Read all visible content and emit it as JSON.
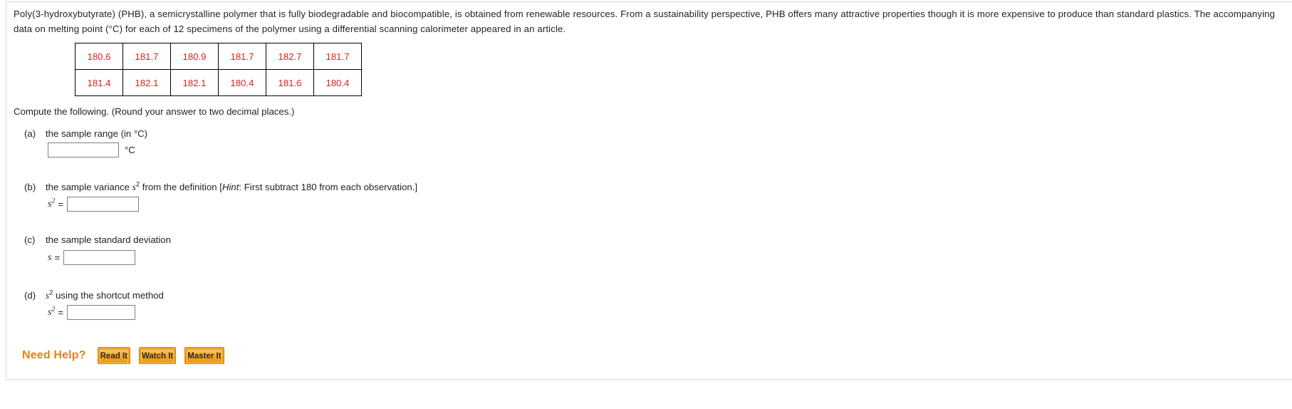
{
  "problem": {
    "statement": "Poly(3-hydroxybutyrate) (PHB), a semicrystalline polymer that is fully biodegradable and biocompatible, is obtained from renewable resources. From a sustainability perspective, PHB offers many attractive properties though it is more expensive to produce than standard plastics. The accompanying data on melting point (°C) for each of 12 specimens of the polymer using a differential scanning calorimeter appeared in an article.",
    "compute_line": "Compute the following. (Round your answer to two decimal places.)"
  },
  "data_table": {
    "rows": [
      [
        "180.6",
        "181.7",
        "180.9",
        "181.7",
        "182.7",
        "181.7"
      ],
      [
        "181.4",
        "182.1",
        "182.1",
        "180.4",
        "181.6",
        "180.4"
      ]
    ],
    "text_color": "#e02020",
    "border_color": "#000000"
  },
  "parts": {
    "a": {
      "letter": "(a)",
      "text_before": "the sample range (in ",
      "unit_inline": "°C",
      "text_after": ")",
      "full_text": "the sample range (in °C)",
      "input_value": "",
      "input_placeholder": "",
      "unit": "°C"
    },
    "b": {
      "letter": "(b)",
      "text_1": "the sample variance ",
      "symbol": "s",
      "exponent": "2",
      "text_2": " from the definition [",
      "hint_label": "Hint",
      "text_3": ": First subtract 180 from each observation.]",
      "full_text": "the sample variance s2 from the definition [Hint: First subtract 180 from each observation.]",
      "answer_symbol": "s",
      "answer_exponent": "2",
      "equals": "=",
      "input_value": "",
      "input_placeholder": ""
    },
    "c": {
      "letter": "(c)",
      "full_text": "the sample standard deviation",
      "answer_symbol": "s",
      "equals": "=",
      "input_value": "",
      "input_placeholder": ""
    },
    "d": {
      "letter": "(d)",
      "symbol": "s",
      "exponent": "2",
      "text_after": " using the shortcut method",
      "full_text": "s2 using the shortcut method",
      "answer_symbol": "s",
      "answer_exponent": "2",
      "equals": "=",
      "input_value": "",
      "input_placeholder": ""
    }
  },
  "need_help": {
    "label": "Need Help?",
    "label_color": "#e8820c",
    "buttons": [
      {
        "label": "Read It",
        "name": "read-it-button"
      },
      {
        "label": "Watch It",
        "name": "watch-it-button"
      },
      {
        "label": "Master It",
        "name": "master-it-button"
      }
    ]
  }
}
